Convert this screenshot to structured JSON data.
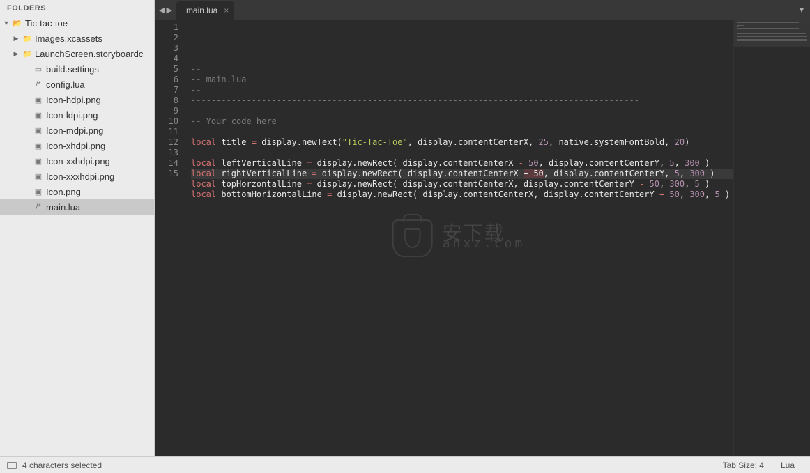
{
  "sidebar": {
    "header": "FOLDERS",
    "tree": [
      {
        "label": "Tic-tac-toe",
        "type": "folder-open",
        "indent": 0,
        "disclosure": "down"
      },
      {
        "label": "Images.xcassets",
        "type": "folder",
        "indent": 1,
        "disclosure": "right"
      },
      {
        "label": "LaunchScreen.storyboardc",
        "type": "folder",
        "indent": 1,
        "disclosure": "right"
      },
      {
        "label": "build.settings",
        "type": "file",
        "indent": 2
      },
      {
        "label": "config.lua",
        "type": "code",
        "indent": 2
      },
      {
        "label": "Icon-hdpi.png",
        "type": "image",
        "indent": 2
      },
      {
        "label": "Icon-ldpi.png",
        "type": "image",
        "indent": 2
      },
      {
        "label": "Icon-mdpi.png",
        "type": "image",
        "indent": 2
      },
      {
        "label": "Icon-xhdpi.png",
        "type": "image",
        "indent": 2
      },
      {
        "label": "Icon-xxhdpi.png",
        "type": "image",
        "indent": 2
      },
      {
        "label": "Icon-xxxhdpi.png",
        "type": "image",
        "indent": 2
      },
      {
        "label": "Icon.png",
        "type": "image",
        "indent": 2
      },
      {
        "label": "main.lua",
        "type": "code",
        "indent": 2,
        "selected": true
      }
    ]
  },
  "tabs": {
    "nav_back": "◀",
    "nav_fwd": "▶",
    "open": [
      {
        "label": "main.lua",
        "close": "×",
        "active": true
      }
    ],
    "menu_icon": "▾"
  },
  "editor": {
    "highlight_line": 12,
    "lines": [
      {
        "n": 1,
        "tokens": [
          {
            "t": "comment",
            "v": "-----------------------------------------------------------------------------------------"
          }
        ]
      },
      {
        "n": 2,
        "tokens": [
          {
            "t": "comment",
            "v": "--"
          }
        ]
      },
      {
        "n": 3,
        "tokens": [
          {
            "t": "comment",
            "v": "-- main.lua"
          }
        ]
      },
      {
        "n": 4,
        "tokens": [
          {
            "t": "comment",
            "v": "--"
          }
        ]
      },
      {
        "n": 5,
        "tokens": [
          {
            "t": "comment",
            "v": "-----------------------------------------------------------------------------------------"
          }
        ]
      },
      {
        "n": 6,
        "tokens": []
      },
      {
        "n": 7,
        "tokens": [
          {
            "t": "comment",
            "v": "-- Your code here"
          }
        ]
      },
      {
        "n": 8,
        "tokens": []
      },
      {
        "n": 9,
        "tokens": [
          {
            "t": "keyword",
            "v": "local"
          },
          {
            "t": "sp",
            "v": " "
          },
          {
            "t": "ident",
            "v": "title"
          },
          {
            "t": "sp",
            "v": " "
          },
          {
            "t": "op",
            "v": "="
          },
          {
            "t": "sp",
            "v": " "
          },
          {
            "t": "func",
            "v": "display.newText("
          },
          {
            "t": "string",
            "v": "\"Tic-Tac-Toe\""
          },
          {
            "t": "func",
            "v": ", display.contentCenterX, "
          },
          {
            "t": "num",
            "v": "25"
          },
          {
            "t": "func",
            "v": ", native.systemFontBold, "
          },
          {
            "t": "num",
            "v": "20"
          },
          {
            "t": "func",
            "v": ")"
          }
        ]
      },
      {
        "n": 10,
        "tokens": []
      },
      {
        "n": 11,
        "tokens": [
          {
            "t": "keyword",
            "v": "local"
          },
          {
            "t": "sp",
            "v": " "
          },
          {
            "t": "ident",
            "v": "leftVerticalLine"
          },
          {
            "t": "sp",
            "v": " "
          },
          {
            "t": "op",
            "v": "="
          },
          {
            "t": "sp",
            "v": " "
          },
          {
            "t": "func",
            "v": "display.newRect( display.contentCenterX "
          },
          {
            "t": "op",
            "v": "-"
          },
          {
            "t": "func",
            "v": " "
          },
          {
            "t": "num",
            "v": "50"
          },
          {
            "t": "func",
            "v": ", display.contentCenterY, "
          },
          {
            "t": "num",
            "v": "5"
          },
          {
            "t": "func",
            "v": ", "
          },
          {
            "t": "num",
            "v": "300"
          },
          {
            "t": "func",
            "v": " )"
          }
        ]
      },
      {
        "n": 12,
        "tokens": [
          {
            "t": "keyword",
            "v": "local"
          },
          {
            "t": "sp",
            "v": " "
          },
          {
            "t": "ident",
            "v": "rightVerticalLine"
          },
          {
            "t": "sp",
            "v": " "
          },
          {
            "t": "op",
            "v": "="
          },
          {
            "t": "sp",
            "v": " "
          },
          {
            "t": "func",
            "v": "display.newRect( display.contentCenterX "
          },
          {
            "t": "sel",
            "v": "+ 50"
          },
          {
            "t": "func",
            "v": ", display.contentCenterY, "
          },
          {
            "t": "num",
            "v": "5"
          },
          {
            "t": "func",
            "v": ", "
          },
          {
            "t": "num",
            "v": "300"
          },
          {
            "t": "func",
            "v": " )"
          }
        ]
      },
      {
        "n": 13,
        "tokens": [
          {
            "t": "keyword",
            "v": "local"
          },
          {
            "t": "sp",
            "v": " "
          },
          {
            "t": "ident",
            "v": "topHorzontalLine"
          },
          {
            "t": "sp",
            "v": " "
          },
          {
            "t": "op",
            "v": "="
          },
          {
            "t": "sp",
            "v": " "
          },
          {
            "t": "func",
            "v": "display.newRect( display.contentCenterX, display.contentCenterY "
          },
          {
            "t": "op",
            "v": "-"
          },
          {
            "t": "func",
            "v": " "
          },
          {
            "t": "num",
            "v": "50"
          },
          {
            "t": "func",
            "v": ", "
          },
          {
            "t": "num",
            "v": "300"
          },
          {
            "t": "func",
            "v": ", "
          },
          {
            "t": "num",
            "v": "5"
          },
          {
            "t": "func",
            "v": " )"
          }
        ]
      },
      {
        "n": 14,
        "tokens": [
          {
            "t": "keyword",
            "v": "local"
          },
          {
            "t": "sp",
            "v": " "
          },
          {
            "t": "ident",
            "v": "bottomHorizontalLine"
          },
          {
            "t": "sp",
            "v": " "
          },
          {
            "t": "op",
            "v": "="
          },
          {
            "t": "sp",
            "v": " "
          },
          {
            "t": "func",
            "v": "display.newRect( display.contentCenterX, display.contentCenterY "
          },
          {
            "t": "op",
            "v": "+"
          },
          {
            "t": "func",
            "v": " "
          },
          {
            "t": "num",
            "v": "50"
          },
          {
            "t": "func",
            "v": ", "
          },
          {
            "t": "num",
            "v": "300"
          },
          {
            "t": "func",
            "v": ", "
          },
          {
            "t": "num",
            "v": "5"
          },
          {
            "t": "func",
            "v": " )"
          }
        ]
      },
      {
        "n": 15,
        "tokens": []
      }
    ]
  },
  "watermark": {
    "cn": "安下载",
    "en": "anxz.com"
  },
  "statusbar": {
    "selection": "4 characters selected",
    "tabsize": "Tab Size: 4",
    "language": "Lua"
  },
  "icons": {
    "folder": "📁",
    "folder-open": "📂",
    "file": "▭",
    "code": "/*",
    "image": "▣"
  }
}
